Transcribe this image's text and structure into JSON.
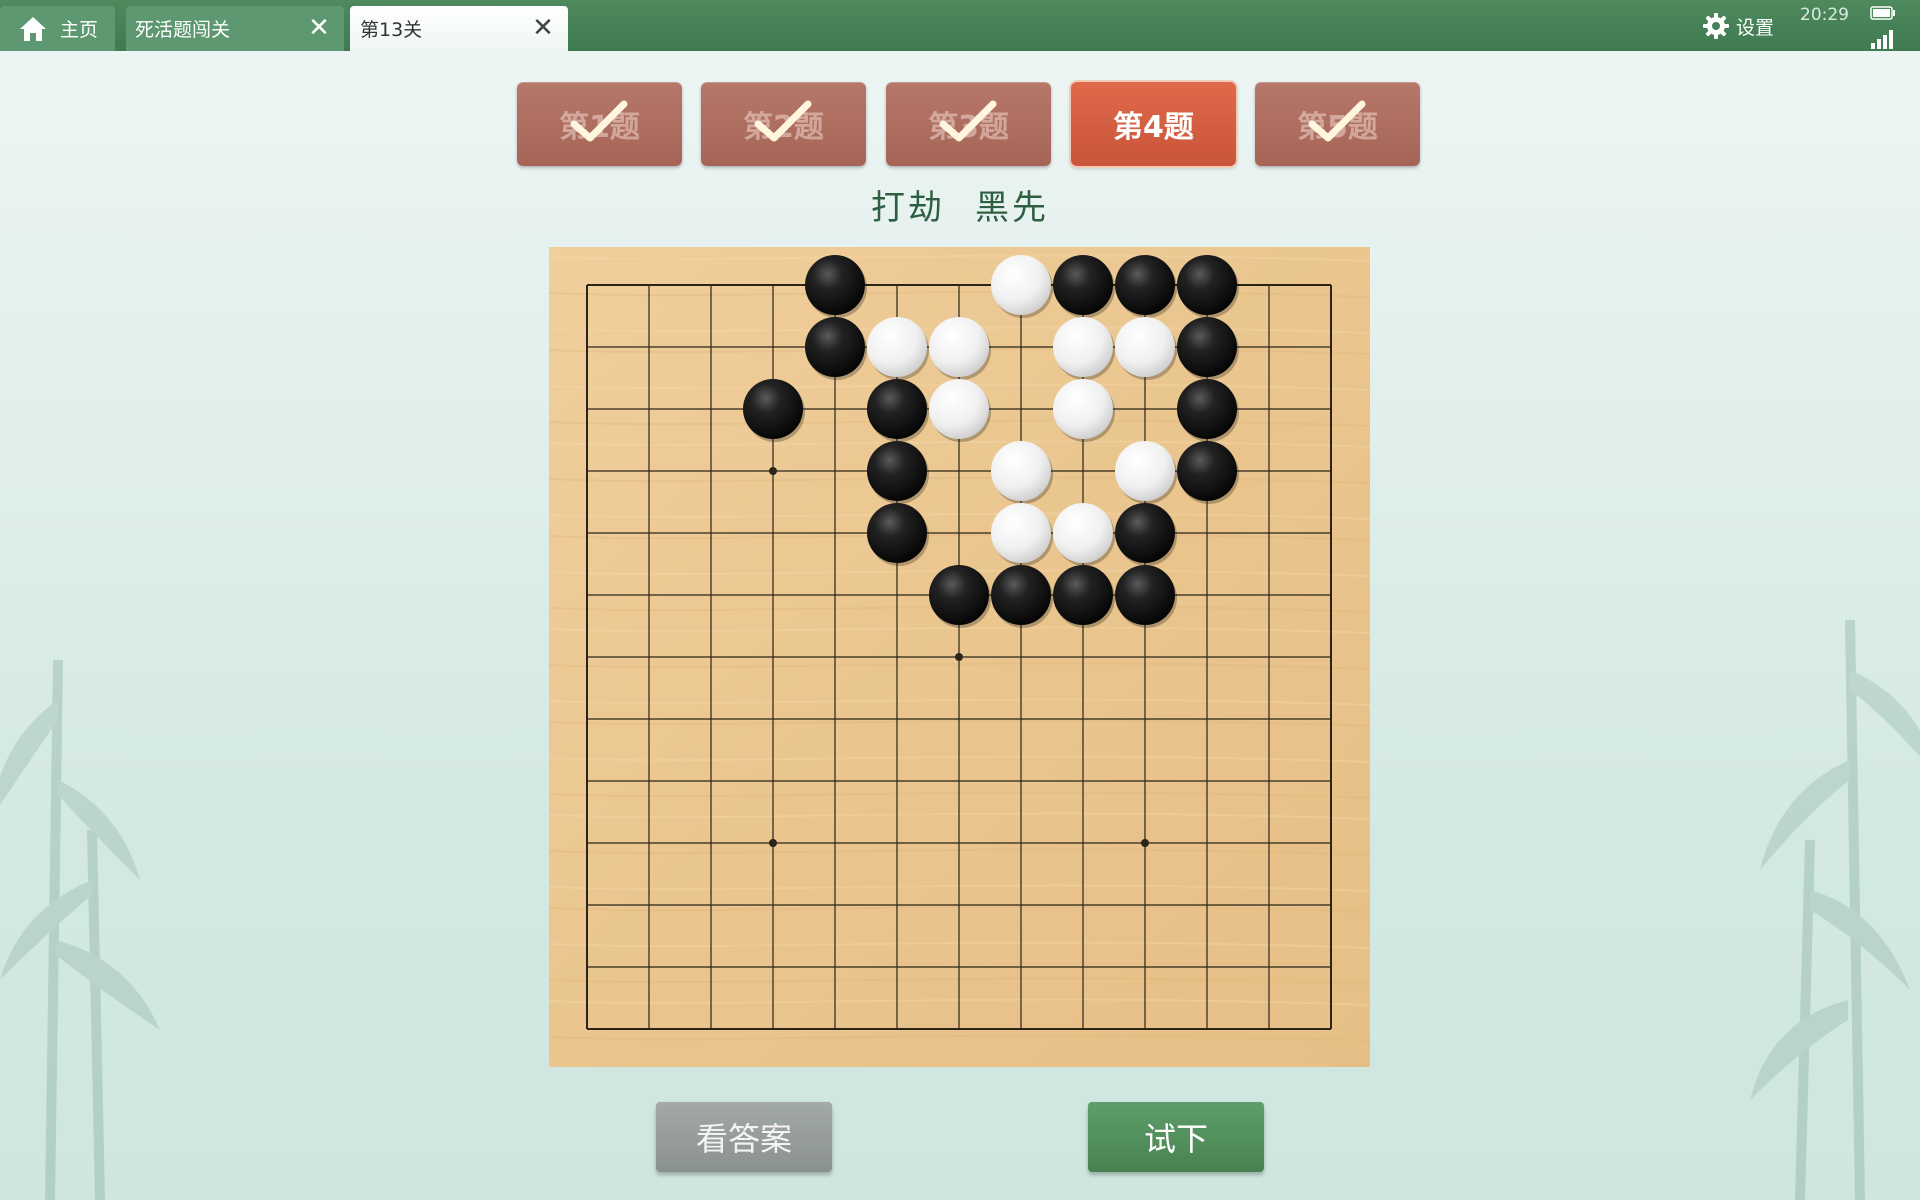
{
  "tabs": {
    "home_label": "主页",
    "dead_live_label": "死活题闯关",
    "level_label": "第13关",
    "close_glyph": "✕"
  },
  "status": {
    "settings_label": "设置",
    "time": "20:29"
  },
  "problems": [
    {
      "label": "第1题",
      "solved": true,
      "active": false
    },
    {
      "label": "第2题",
      "solved": true,
      "active": false
    },
    {
      "label": "第3题",
      "solved": true,
      "active": false
    },
    {
      "label": "第4题",
      "solved": false,
      "active": true
    },
    {
      "label": "第5题",
      "solved": true,
      "active": false
    }
  ],
  "problem": {
    "goal": "打劫",
    "turn": "黑先"
  },
  "board": {
    "size": 13,
    "star_points": [
      [
        3,
        3
      ],
      [
        3,
        9
      ],
      [
        6,
        6
      ],
      [
        9,
        3
      ],
      [
        9,
        9
      ]
    ],
    "stones": [
      {
        "color": "black",
        "col": 4,
        "row": 0
      },
      {
        "color": "white",
        "col": 7,
        "row": 0
      },
      {
        "color": "black",
        "col": 8,
        "row": 0
      },
      {
        "color": "black",
        "col": 9,
        "row": 0
      },
      {
        "color": "black",
        "col": 10,
        "row": 0
      },
      {
        "color": "black",
        "col": 4,
        "row": 1
      },
      {
        "color": "white",
        "col": 5,
        "row": 1
      },
      {
        "color": "white",
        "col": 6,
        "row": 1
      },
      {
        "color": "white",
        "col": 8,
        "row": 1
      },
      {
        "color": "white",
        "col": 9,
        "row": 1
      },
      {
        "color": "black",
        "col": 10,
        "row": 1
      },
      {
        "color": "black",
        "col": 3,
        "row": 2
      },
      {
        "color": "black",
        "col": 5,
        "row": 2
      },
      {
        "color": "white",
        "col": 6,
        "row": 2
      },
      {
        "color": "white",
        "col": 8,
        "row": 2
      },
      {
        "color": "black",
        "col": 10,
        "row": 2
      },
      {
        "color": "black",
        "col": 5,
        "row": 3
      },
      {
        "color": "white",
        "col": 7,
        "row": 3
      },
      {
        "color": "white",
        "col": 9,
        "row": 3
      },
      {
        "color": "black",
        "col": 10,
        "row": 3
      },
      {
        "color": "black",
        "col": 5,
        "row": 4
      },
      {
        "color": "white",
        "col": 7,
        "row": 4
      },
      {
        "color": "white",
        "col": 8,
        "row": 4
      },
      {
        "color": "black",
        "col": 9,
        "row": 4
      },
      {
        "color": "black",
        "col": 6,
        "row": 5
      },
      {
        "color": "black",
        "col": 7,
        "row": 5
      },
      {
        "color": "black",
        "col": 8,
        "row": 5
      },
      {
        "color": "black",
        "col": 9,
        "row": 5
      }
    ]
  },
  "actions": {
    "answer_label": "看答案",
    "try_label": "试下"
  },
  "colors": {
    "topbar": "#44805a",
    "button_done": "#ad6d5f",
    "button_active": "#d65f42",
    "board_wood": "#ecc993",
    "try_button": "#50895a",
    "answer_button": "#959c98",
    "title_text": "#2f5f42"
  },
  "icons": {
    "home": "home-icon",
    "settings": "gear-icon",
    "check": "check-icon",
    "close": "close-icon"
  }
}
